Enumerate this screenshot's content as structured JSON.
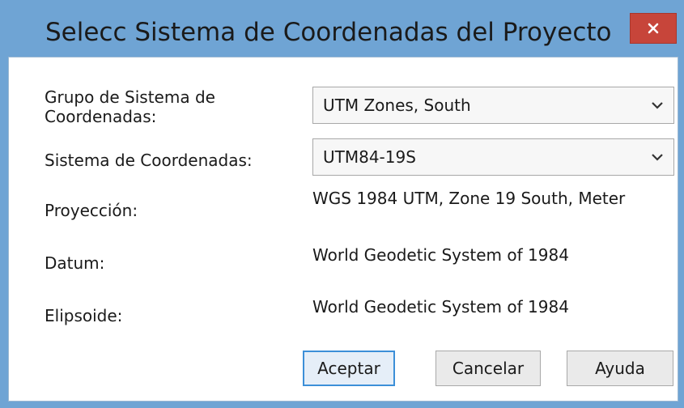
{
  "window": {
    "title": "Selecc Sistema de Coordenadas del Proyecto",
    "close_icon": "close-icon",
    "accent_color": "#6fa4d4",
    "close_color": "#c7453a"
  },
  "form": {
    "group_label": "Grupo de Sistema de Coordenadas:",
    "group_value": "UTM Zones, South",
    "system_label": "Sistema de Coordenadas:",
    "system_value": "UTM84-19S",
    "projection_label": "Proyección:",
    "projection_value": "WGS 1984 UTM, Zone 19 South, Meter",
    "datum_label": "Datum:",
    "datum_value": "World Geodetic System of 1984",
    "ellipsoid_label": "Elipsoide:",
    "ellipsoid_value": "World Geodetic System of 1984",
    "dropdown_icon": "chevron-down-icon"
  },
  "buttons": {
    "accept": "Aceptar",
    "cancel": "Cancelar",
    "help": "Ayuda"
  }
}
